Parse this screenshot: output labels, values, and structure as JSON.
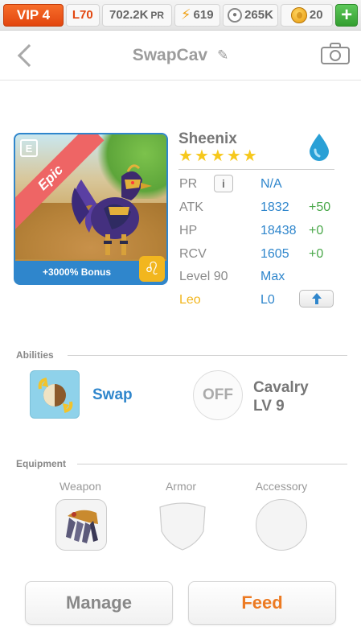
{
  "topbar": {
    "vip": "VIP 4",
    "level": "L70",
    "pr": "702.2K",
    "pr_unit": "PR",
    "energy": "619",
    "food": "265K",
    "coins": "20"
  },
  "header": {
    "title": "SwapCav"
  },
  "creature": {
    "rarity": "Epic",
    "bonus": "+3000% Bonus",
    "name": "Sheenix",
    "stars": 5,
    "stats": [
      {
        "label": "PR",
        "value": "N/A",
        "bonus": ""
      },
      {
        "label": "ATK",
        "value": "1832",
        "bonus": "+50"
      },
      {
        "label": "HP",
        "value": "18438",
        "bonus": "+0"
      },
      {
        "label": "RCV",
        "value": "1605",
        "bonus": "+0"
      },
      {
        "label": "Level 90",
        "value": "Max",
        "bonus": ""
      },
      {
        "label": "Leo",
        "value": "L0",
        "bonus": ""
      }
    ]
  },
  "abilities": {
    "heading": "Abilities",
    "primary": "Swap",
    "secondary_state": "OFF",
    "secondary_name": "Cavalry",
    "secondary_level": "LV 9"
  },
  "equipment": {
    "heading": "Equipment",
    "slots": [
      "Weapon",
      "Armor",
      "Accessory"
    ]
  },
  "actions": {
    "manage": "Manage",
    "feed": "Feed"
  },
  "colors": {
    "accent_blue": "#2f86cc",
    "feed_orange": "#ec7a22",
    "bonus_green": "#4aa84a",
    "leo_yellow": "#f2b61e",
    "vip_orange": "#e2460f"
  }
}
